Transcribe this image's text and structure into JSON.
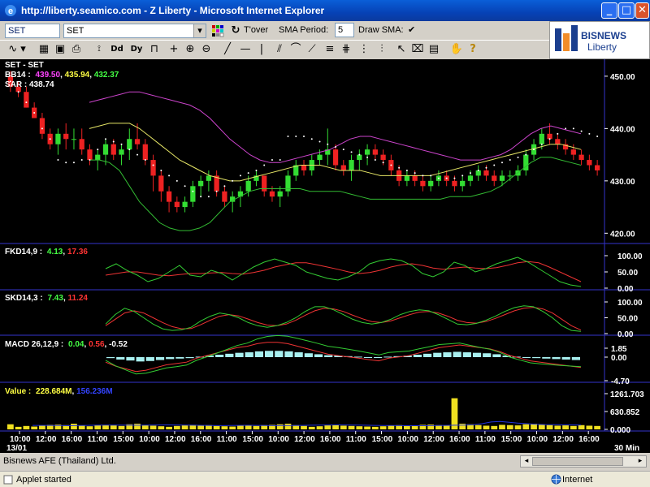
{
  "window": {
    "title": "http://liberty.seamico.com - Z Liberty - Microsoft Internet Explorer",
    "min": "_",
    "max": "□",
    "close": "✕"
  },
  "toolbar": {
    "symbol_code": "SET",
    "symbol_select": "SET",
    "tover_label": "T'over",
    "sma_period_label": "SMA Period:",
    "sma_period_value": "5",
    "draw_sma_label": "Draw SMA:",
    "draw_sma_checked": "✔",
    "dropdown_glyph": "▾"
  },
  "logo": {
    "brand": "BISNEWS",
    "sub": "Liberty",
    "colors": {
      "navy": "#1b3f8f",
      "orange": "#f28c28"
    }
  },
  "chart_data": {
    "type": "candlestick",
    "header": {
      "title": "SET - SET",
      "bb_label": "BB14 :",
      "bb_upper": "439.50",
      "bb_mid": "435.94",
      "bb_lower": "432.37",
      "sar_label": "SAR : 438.74"
    },
    "price_axis": {
      "ticks": [
        "450.00",
        "440.00",
        "430.00",
        "420.00"
      ],
      "ylim": [
        418.5,
        452
      ]
    },
    "time_axis": [
      "10:00",
      "12:00",
      "16:00",
      "11:00",
      "15:00",
      "10:00",
      "12:00",
      "16:00",
      "11:00",
      "15:00",
      "10:00",
      "12:00",
      "16:00",
      "11:00",
      "15:00",
      "10:00",
      "12:00",
      "16:00",
      "11:00",
      "15:00",
      "10:00",
      "12:00",
      "16:00"
    ],
    "date_label": "13/01",
    "interval_label": "30 Min",
    "candles": [
      [
        450,
        451,
        447,
        448
      ],
      [
        448,
        449,
        446,
        447
      ],
      [
        447,
        448,
        444,
        444
      ],
      [
        444,
        445,
        442,
        442
      ],
      [
        442,
        443,
        438,
        439
      ],
      [
        439,
        440,
        436,
        437
      ],
      [
        437,
        440,
        435,
        439
      ],
      [
        439,
        441,
        436,
        438
      ],
      [
        438,
        440,
        436,
        438
      ],
      [
        438,
        440,
        435,
        436
      ],
      [
        436,
        437,
        433,
        434
      ],
      [
        434,
        436,
        432,
        435
      ],
      [
        435,
        438,
        433,
        437
      ],
      [
        437,
        438,
        434,
        435
      ],
      [
        435,
        437,
        433,
        436
      ],
      [
        436,
        440,
        434,
        438
      ],
      [
        438,
        441,
        436,
        437
      ],
      [
        437,
        438,
        433,
        434
      ],
      [
        434,
        435,
        428,
        431
      ],
      [
        431,
        432,
        426,
        428
      ],
      [
        428,
        429,
        424,
        426
      ],
      [
        426,
        427,
        424,
        425
      ],
      [
        425,
        427,
        424,
        426
      ],
      [
        426,
        430,
        425,
        429
      ],
      [
        429,
        431,
        427,
        430
      ],
      [
        430,
        432,
        428,
        431
      ],
      [
        431,
        432,
        427,
        428
      ],
      [
        428,
        429,
        425,
        426
      ],
      [
        426,
        428,
        424,
        427
      ],
      [
        427,
        429,
        425,
        428
      ],
      [
        428,
        431,
        427,
        430
      ],
      [
        430,
        432,
        429,
        431
      ],
      [
        431,
        430,
        427,
        428
      ],
      [
        428,
        429,
        426,
        427
      ],
      [
        427,
        429,
        425,
        428
      ],
      [
        428,
        432,
        427,
        431
      ],
      [
        431,
        434,
        430,
        433
      ],
      [
        433,
        434,
        431,
        432
      ],
      [
        432,
        435,
        431,
        434
      ],
      [
        434,
        436,
        433,
        435
      ],
      [
        435,
        440,
        433,
        436
      ],
      [
        436,
        437,
        432,
        433
      ],
      [
        433,
        434,
        431,
        432
      ],
      [
        432,
        435,
        430,
        434
      ],
      [
        434,
        436,
        432,
        435
      ],
      [
        435,
        437,
        433,
        436
      ],
      [
        436,
        437,
        434,
        435
      ],
      [
        435,
        436,
        433,
        434
      ],
      [
        434,
        435,
        431,
        432
      ],
      [
        432,
        433,
        429,
        430
      ],
      [
        430,
        432,
        429,
        431
      ],
      [
        431,
        432,
        429,
        430
      ],
      [
        430,
        431,
        428,
        429
      ],
      [
        429,
        431,
        428,
        430
      ],
      [
        430,
        432,
        429,
        431
      ],
      [
        431,
        432,
        429,
        430
      ],
      [
        430,
        431,
        428,
        429
      ],
      [
        429,
        431,
        428,
        430
      ],
      [
        430,
        432,
        429,
        431
      ],
      [
        431,
        433,
        430,
        432
      ],
      [
        432,
        433,
        430,
        431
      ],
      [
        431,
        432,
        429,
        430
      ],
      [
        430,
        432,
        429,
        431
      ],
      [
        431,
        432,
        430,
        431
      ],
      [
        431,
        433,
        430,
        432
      ],
      [
        432,
        436,
        431,
        435
      ],
      [
        435,
        438,
        434,
        437
      ],
      [
        437,
        440,
        436,
        439
      ],
      [
        439,
        441,
        437,
        438
      ],
      [
        438,
        439,
        436,
        437
      ],
      [
        437,
        438,
        435,
        436
      ],
      [
        436,
        437,
        434,
        435
      ],
      [
        435,
        436,
        433,
        434
      ],
      [
        434,
        435,
        432,
        433
      ],
      [
        433,
        434,
        431,
        432
      ]
    ],
    "bb_upper": [
      445,
      445.5,
      446,
      446.5,
      447,
      447,
      446.5,
      446,
      445.5,
      445,
      444.5,
      443.5,
      442,
      440,
      438,
      436.5,
      435,
      434,
      433.5,
      433.5,
      434,
      434.5,
      435,
      435.5,
      436,
      437,
      438,
      438.5,
      438.5,
      438,
      437.5,
      437,
      436.5,
      436,
      435.5,
      435,
      434.5,
      434,
      434,
      434,
      434.5,
      435,
      436,
      437.5,
      439,
      440,
      440.5,
      440,
      439.5,
      439
    ],
    "bb_mid": [
      440,
      440.5,
      441,
      441,
      441,
      440,
      438.5,
      437,
      435.5,
      434,
      433,
      432,
      431,
      430.5,
      430,
      430,
      430.5,
      431,
      431.5,
      432,
      432.5,
      433,
      433,
      433,
      432.5,
      432,
      432,
      432,
      431.5,
      431,
      431,
      431,
      431,
      431,
      431,
      431.5,
      432,
      432.5,
      433,
      433.5,
      434,
      434.5,
      435,
      435.5,
      436,
      436.5,
      437,
      437,
      436.5,
      436
    ],
    "bb_lower": [
      434,
      434,
      433.5,
      432,
      429,
      426,
      424,
      422,
      421,
      420.5,
      420.5,
      421,
      422,
      424,
      426,
      427,
      428,
      428.5,
      428.5,
      428.5,
      428.5,
      428.5,
      428,
      428,
      428,
      428,
      427.5,
      427,
      426.5,
      426.5,
      426.5,
      426.5,
      426.5,
      426.5,
      426.5,
      426.5,
      427,
      427,
      427,
      427.5,
      428,
      429,
      430.5,
      432,
      433.5,
      434.5,
      434.5,
      434,
      433.5,
      433
    ],
    "sar": [
      449,
      447,
      445,
      443,
      440,
      438,
      434,
      433.5,
      433.5,
      434,
      434,
      436,
      438,
      437.5,
      437,
      436,
      435,
      434,
      433,
      432,
      431,
      430,
      429,
      428,
      427,
      427,
      428,
      429,
      430,
      431,
      431.5,
      432,
      433,
      434,
      434,
      438.5,
      438.5,
      438.5,
      438,
      437.5,
      437,
      436.5,
      436,
      435.5,
      435,
      434.5,
      434,
      433.5,
      433,
      432.5,
      432,
      431.5,
      431,
      431,
      430.5,
      430.5,
      430.5,
      431,
      431.5,
      432,
      432.5,
      433,
      433.5,
      434,
      434.5,
      435,
      436,
      437,
      438,
      439,
      440,
      440,
      439.5,
      439,
      438.5
    ],
    "fkd": {
      "label": "FKD14,9 :",
      "k": "4.13",
      "d": "17.36",
      "ticks": [
        "100.00",
        "50.00",
        "0.00"
      ],
      "k_values": [
        60,
        75,
        55,
        40,
        20,
        30,
        50,
        70,
        40,
        35,
        55,
        45,
        25,
        45,
        65,
        80,
        90,
        80,
        70,
        50,
        40,
        30,
        25,
        35,
        50,
        75,
        85,
        90,
        85,
        70,
        45,
        35,
        50,
        80,
        70,
        50,
        60,
        75,
        85,
        95,
        80,
        60,
        40,
        20,
        10,
        5
      ],
      "d_values": [
        40,
        45,
        50,
        50,
        45,
        40,
        38,
        42,
        45,
        45,
        47,
        48,
        45,
        43,
        48,
        55,
        65,
        72,
        78,
        78,
        72,
        65,
        58,
        50,
        45,
        48,
        55,
        65,
        72,
        75,
        70,
        62,
        58,
        62,
        65,
        62,
        60,
        63,
        70,
        78,
        82,
        78,
        65,
        50,
        35,
        20
      ]
    },
    "skd": {
      "label": "SKD14,3 :",
      "k": "7.43",
      "d": "11.24",
      "ticks": [
        "100.00",
        "50.00",
        "0.00"
      ],
      "k_values": [
        30,
        60,
        80,
        70,
        50,
        30,
        15,
        10,
        12,
        20,
        40,
        55,
        65,
        60,
        50,
        35,
        25,
        20,
        25,
        35,
        50,
        70,
        85,
        85,
        75,
        60,
        45,
        35,
        30,
        35,
        45,
        60,
        70,
        75,
        72,
        60,
        45,
        30,
        28,
        32,
        42,
        55,
        70,
        82,
        88,
        85,
        70,
        50,
        25,
        10,
        7
      ],
      "d_values": [
        25,
        45,
        65,
        72,
        65,
        50,
        35,
        22,
        15,
        16,
        28,
        42,
        55,
        60,
        56,
        46,
        35,
        27,
        25,
        30,
        42,
        58,
        72,
        80,
        78,
        70,
        58,
        47,
        38,
        35,
        40,
        50,
        60,
        68,
        70,
        65,
        55,
        42,
        35,
        33,
        38,
        48,
        60,
        72,
        80,
        83,
        78,
        65,
        45,
        25,
        11
      ]
    },
    "macd": {
      "label": "MACD 26,12,9 :",
      "v1": "0.04",
      "v2": "0.56",
      "v3": "-0.52",
      "ticks": [
        "1.85",
        "0.00",
        "-4.70"
      ],
      "hist": [
        -0.2,
        -0.5,
        -0.7,
        -0.9,
        -0.8,
        -0.6,
        -0.4,
        -0.3,
        -0.2,
        0.1,
        0.3,
        0.5,
        0.7,
        0.9,
        1.0,
        1.2,
        1.3,
        1.3,
        1.2,
        1.0,
        0.8,
        0.6,
        0.4,
        0.3,
        0.2,
        0.1,
        0.0,
        -0.1,
        0.1,
        0.2,
        0.3,
        0.5,
        0.7,
        0.9,
        1.0,
        1.1,
        1.0,
        0.9,
        0.8,
        0.6,
        0.3,
        0.1,
        -0.1,
        -0.2,
        -0.3,
        -0.4,
        -0.5,
        -0.6
      ]
    },
    "volume": {
      "label": "Value :",
      "v1": "228.684M",
      "v2": "156.236M",
      "ticks": [
        "1261.703",
        "630.852",
        "0.000"
      ],
      "bars": [
        180,
        90,
        120,
        100,
        140,
        160,
        170,
        150,
        200,
        130,
        110,
        150,
        160,
        140,
        120,
        180,
        200,
        150,
        130,
        110,
        90,
        120,
        140,
        160,
        130,
        150,
        120,
        110,
        100,
        130,
        140,
        120,
        150,
        160,
        180,
        200,
        150,
        120,
        90,
        110,
        140,
        160,
        130,
        120,
        110,
        100,
        90,
        110,
        130,
        150,
        120,
        140,
        160,
        170,
        150,
        130,
        1100,
        200,
        180,
        150,
        130,
        120,
        160,
        150,
        140,
        180,
        200,
        170,
        150,
        130,
        140,
        120,
        150,
        130,
        120
      ],
      "ma": [
        140,
        140,
        140,
        135,
        130,
        135,
        140,
        145,
        150,
        150,
        148,
        145,
        145,
        150,
        155,
        158,
        155,
        150,
        145,
        140,
        135,
        132,
        135,
        140,
        142,
        140,
        135,
        132,
        135,
        138,
        140,
        145,
        150,
        155,
        158,
        155,
        150,
        145,
        140,
        138,
        135,
        132,
        130,
        128,
        130,
        135,
        140,
        145,
        150,
        160,
        200,
        260,
        280,
        250,
        220,
        200,
        180,
        170,
        165,
        160,
        158,
        155
      ]
    }
  },
  "status": {
    "company": "Bisnews AFE (Thailand) Ltd.",
    "applet": "Applet started",
    "zone": "Internet"
  }
}
